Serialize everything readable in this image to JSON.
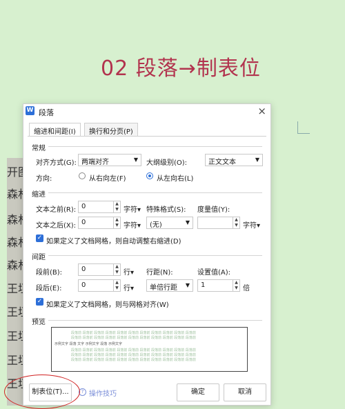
{
  "slide": {
    "heading": "02 段落→制表位",
    "doc_chars": [
      "开图",
      "森林",
      "森林",
      "森林",
      "森林",
      "王垣",
      "王垣",
      "王垣",
      "王垣",
      "王垣",
      "开图"
    ]
  },
  "dialog": {
    "app_icon": "W",
    "title": "段落",
    "close": "×",
    "tabs": {
      "indent": "缩进和间距(I)",
      "linebreak": "换行和分页(P)"
    },
    "general": {
      "section": "常规",
      "align_label": "对齐方式(G):",
      "align_value": "两端对齐",
      "outline_label": "大纲级别(O):",
      "outline_value": "正文文本",
      "direction_label": "方向:",
      "rtl_label": "从右向左(F)",
      "ltr_label": "从左向右(L)",
      "direction_selected": "ltr"
    },
    "indent": {
      "section": "缩进",
      "before_label": "文本之前(R):",
      "before_value": "0",
      "before_unit": "字符▾",
      "after_label": "文本之后(X):",
      "after_value": "0",
      "after_unit": "字符▾",
      "special_label": "特殊格式(S):",
      "special_value": "(无)",
      "measure_label": "度量值(Y):",
      "measure_value": "",
      "measure_unit": "字符▾",
      "auto_adjust_label": "如果定义了文档网格，则自动调整右缩进(D)",
      "auto_adjust_checked": true
    },
    "spacing": {
      "section": "间距",
      "before_label": "段前(B):",
      "before_value": "0",
      "before_unit": "行▾",
      "after_label": "段后(E):",
      "after_value": "0",
      "after_unit": "行▾",
      "line_label": "行距(N):",
      "line_value": "单倍行距",
      "setting_label": "设置值(A):",
      "setting_value": "1",
      "setting_unit": "倍",
      "snap_label": "如果定义了文档网格，则与网格对齐(W)",
      "snap_checked": true
    },
    "preview": {
      "section": "预览",
      "sample_text": "段落前 段落前 段落前 段落前 段落前 段落前 段落前 段落前 段落前 段落前 段落前",
      "current_text": "示例文字 段落 文字 示例文字 段落 示例文字"
    },
    "buttons": {
      "tabs": "制表位(T)...",
      "tips": "操作技巧",
      "ok": "确定",
      "cancel": "取消"
    }
  },
  "colors": {
    "background": "#d7f0cf",
    "accent": "#2d6fd8",
    "heading": "#b2334e",
    "annotation": "#d02020"
  }
}
